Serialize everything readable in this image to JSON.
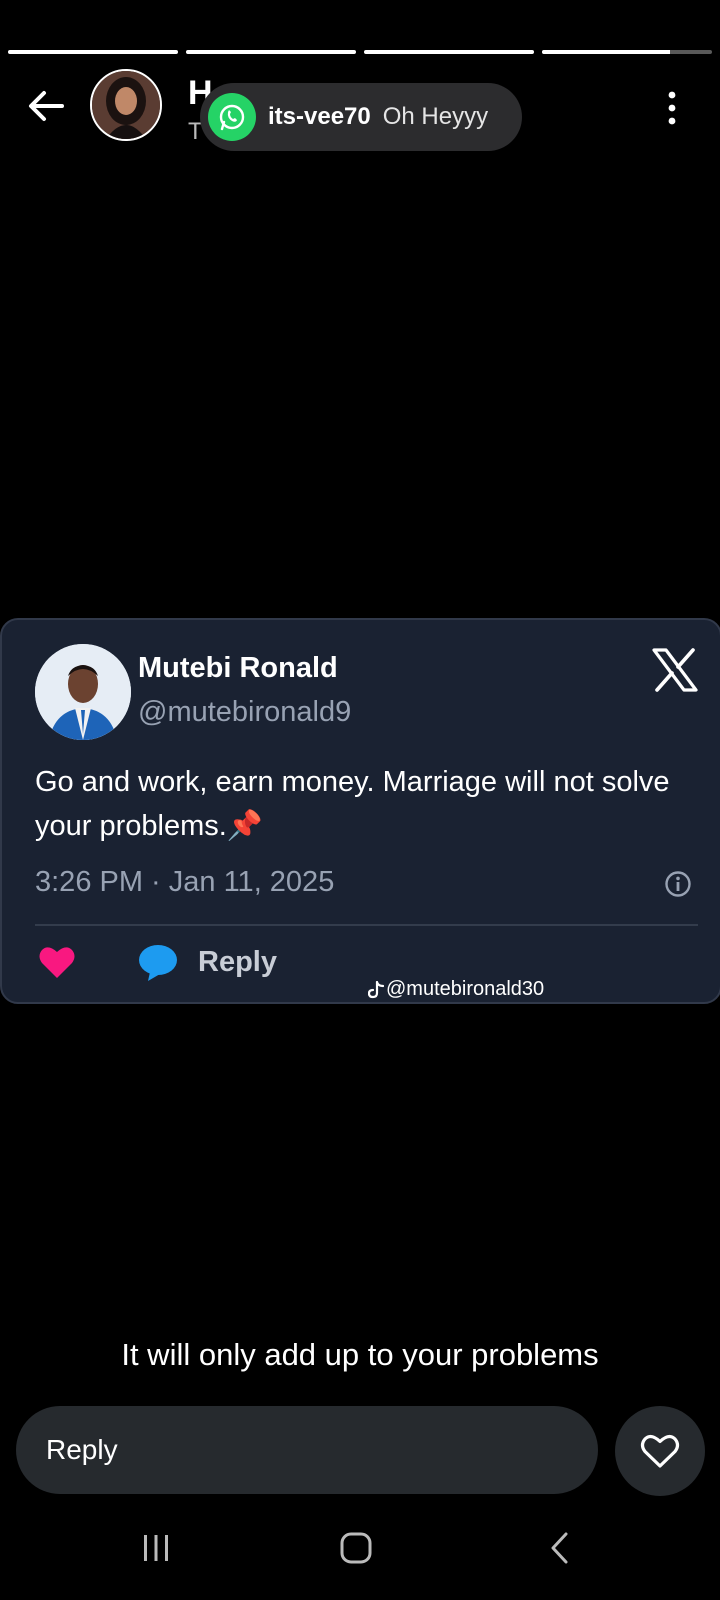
{
  "story": {
    "progress": [
      1.0,
      1.0,
      1.0,
      0.75
    ],
    "user_name": "H",
    "user_sub": "T"
  },
  "notification": {
    "app_icon": "whatsapp-icon",
    "sender": "its-vee70",
    "message": "Oh Heyyy",
    "accent_color": "#25d366"
  },
  "tweet": {
    "name": "Mutebi Ronald",
    "handle": "@mutebironald9",
    "text": "Go and work, earn money. Marriage will not solve your problems.",
    "emoji": "📌",
    "time": "3:26 PM · Jan 11, 2025",
    "reply_label": "Reply",
    "watermark": "@mutebironald30",
    "heart_color": "#f91880",
    "reply_color": "#1d9bf0"
  },
  "caption": "It will only add up to your problems",
  "reply_bar": {
    "placeholder": "Reply"
  },
  "nav": {
    "recents": "recents-icon",
    "home": "home-icon",
    "back": "back-icon"
  }
}
